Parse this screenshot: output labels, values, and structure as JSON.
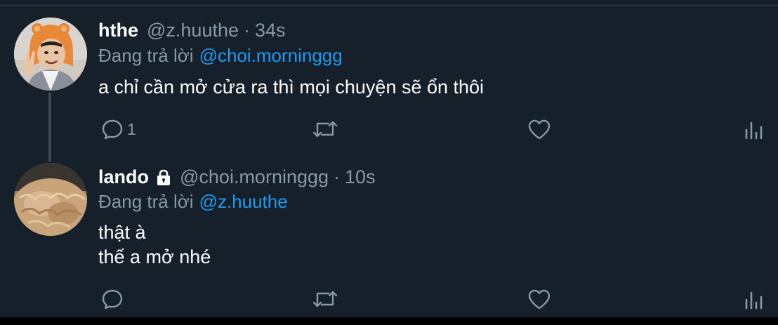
{
  "colors": {
    "background": "#15202b",
    "text_primary": "#ffffff",
    "text_secondary": "#8899a6",
    "accent": "#1d9bf0",
    "divider": "#38444d"
  },
  "tweets": [
    {
      "display_name": "hthe",
      "handle": "@z.huuthe",
      "separator": "·",
      "timestamp": "34s",
      "reply_label": "Đang trả lời",
      "reply_to": "@choi.morninggg",
      "text_lines": [
        "a chỉ cần mở cửa ra thì mọi chuyện sẽ ổn thôi"
      ],
      "actions": {
        "reply_count": "1",
        "icons": [
          "reply-icon",
          "retweet-icon",
          "like-icon",
          "views-icon"
        ]
      },
      "avatar_icon": "avatar-photo"
    },
    {
      "display_name": "lando",
      "protected": true,
      "protected_icon": "lock-icon",
      "handle": "@choi.morninggg",
      "separator": "·",
      "timestamp": "10s",
      "reply_label": "Đang trả lời",
      "reply_to": "@z.huuthe",
      "text_lines": [
        "thật à",
        "thế a mở nhé"
      ],
      "actions": {
        "reply_count": "",
        "icons": [
          "reply-icon",
          "retweet-icon",
          "like-icon",
          "views-icon"
        ]
      },
      "avatar_icon": "avatar-photo"
    }
  ]
}
